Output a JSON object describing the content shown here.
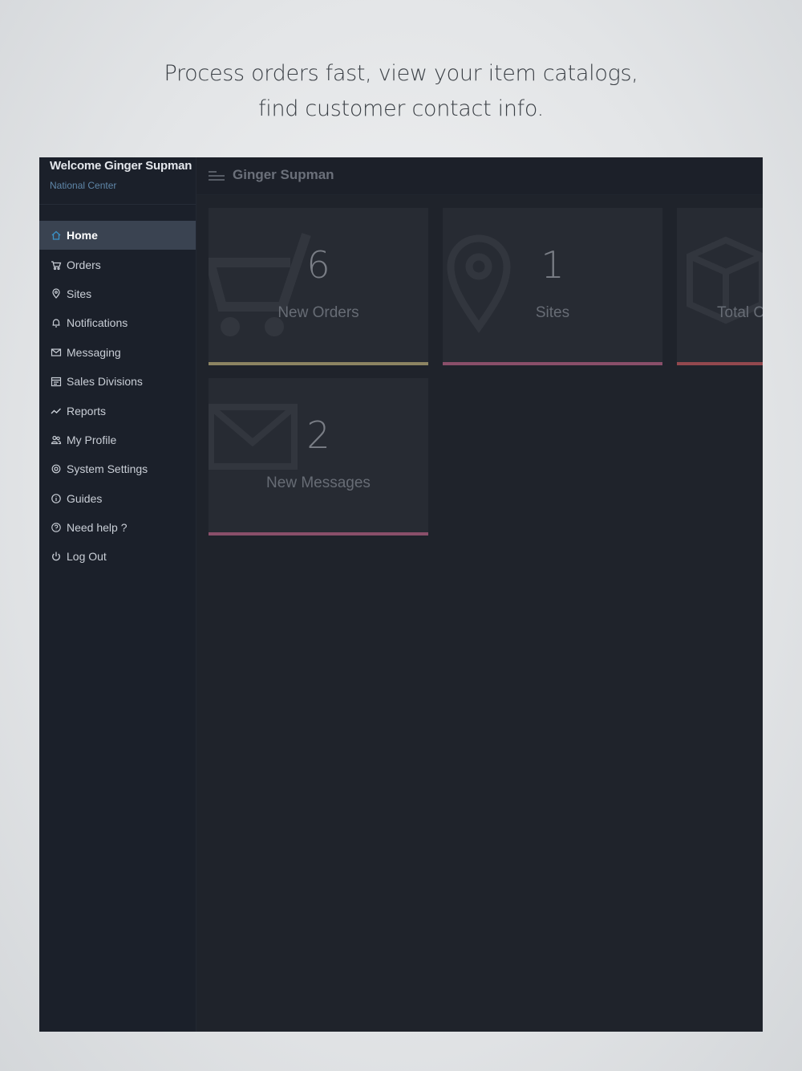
{
  "tagline": {
    "line1": "Process orders fast, view your item catalogs,",
    "line2": "find customer contact info."
  },
  "sidebar": {
    "welcome": "Welcome Ginger Supman",
    "subtitle": "National Center",
    "items": [
      {
        "label": "Home",
        "icon": "home-icon",
        "active": true
      },
      {
        "label": "Orders",
        "icon": "cart-icon"
      },
      {
        "label": "Sites",
        "icon": "location-icon"
      },
      {
        "label": "Notifications",
        "icon": "bell-icon"
      },
      {
        "label": "Messaging",
        "icon": "envelope-icon"
      },
      {
        "label": "Sales Divisions",
        "icon": "calendar-icon"
      },
      {
        "label": "Reports",
        "icon": "trend-icon"
      },
      {
        "label": "My Profile",
        "icon": "users-icon"
      },
      {
        "label": "System Settings",
        "icon": "gear-icon"
      },
      {
        "label": "Guides",
        "icon": "info-icon"
      },
      {
        "label": "Need help ?",
        "icon": "help-icon"
      },
      {
        "label": "Log Out",
        "icon": "power-icon"
      }
    ]
  },
  "header": {
    "title": "Ginger Supman",
    "menu_icon": "hamburger-icon"
  },
  "cards": [
    {
      "count": "6",
      "label": "New Orders",
      "icon": "cart-icon",
      "accent": "#8c8462"
    },
    {
      "count": "1",
      "label": "Sites",
      "icon": "location-icon",
      "accent": "#8a4f6a"
    },
    {
      "count": "",
      "label": "Total C",
      "icon": "box-icon",
      "accent": "#93484e"
    },
    {
      "count": "2",
      "label": "New Messages",
      "icon": "envelope-icon",
      "accent": "#8a4f6a"
    }
  ],
  "colors": {
    "accent_active": "#3a92c8",
    "background": "#1f232b",
    "sidebar": "#1b202a"
  }
}
